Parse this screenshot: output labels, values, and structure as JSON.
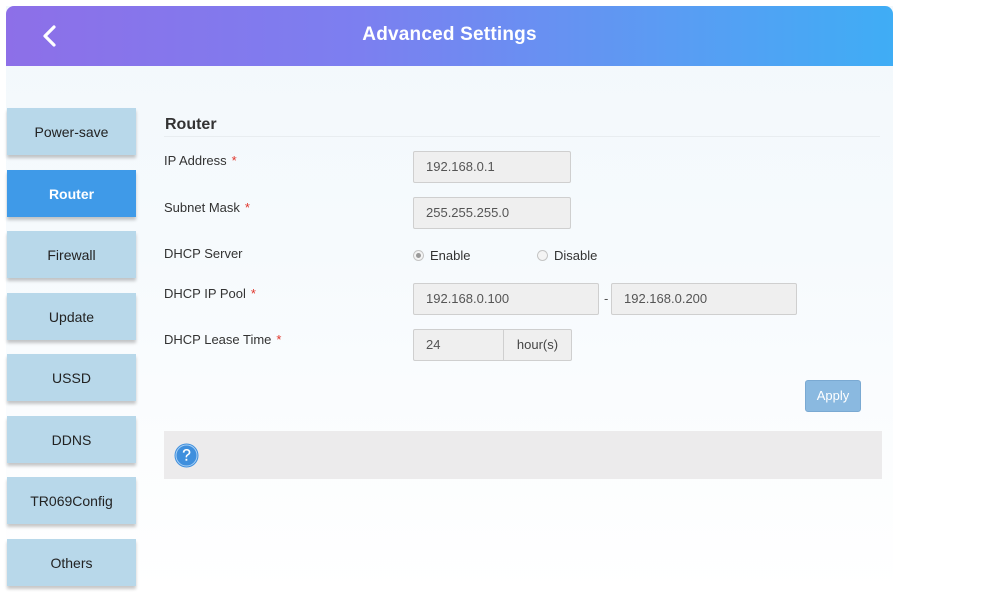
{
  "header": {
    "title": "Advanced Settings",
    "back_icon": "chevron-left-icon",
    "gradient": [
      "#8d6fe8",
      "#3fadf5"
    ]
  },
  "sidebar": {
    "items": [
      {
        "label": "Power-save",
        "active": false
      },
      {
        "label": "Router",
        "active": true
      },
      {
        "label": "Firewall",
        "active": false
      },
      {
        "label": "Update",
        "active": false
      },
      {
        "label": "USSD",
        "active": false
      },
      {
        "label": "DDNS",
        "active": false
      },
      {
        "label": "TR069Config",
        "active": false
      },
      {
        "label": "Others",
        "active": false
      }
    ],
    "active_color": "#3f9ae8",
    "item_color": "#b8d8ea"
  },
  "router": {
    "section_title": "Router",
    "ip_address": {
      "label": "IP Address",
      "required": "*",
      "value": "192.168.0.1"
    },
    "subnet_mask": {
      "label": "Subnet Mask",
      "required": "*",
      "value": "255.255.255.0"
    },
    "dhcp_server": {
      "label": "DHCP Server",
      "options": [
        {
          "label": "Enable",
          "selected": true
        },
        {
          "label": "Disable",
          "selected": false
        }
      ]
    },
    "dhcp_ip_pool": {
      "label": "DHCP IP Pool",
      "required": "*",
      "start": "192.168.0.100",
      "separator": "-",
      "end": "192.168.0.200"
    },
    "dhcp_lease_time": {
      "label": "DHCP Lease Time",
      "required": "*",
      "value": "24",
      "unit": "hour(s)"
    },
    "apply_label": "Apply"
  },
  "help": {
    "icon": "question-circle-icon",
    "color": "#3f8fdd"
  }
}
